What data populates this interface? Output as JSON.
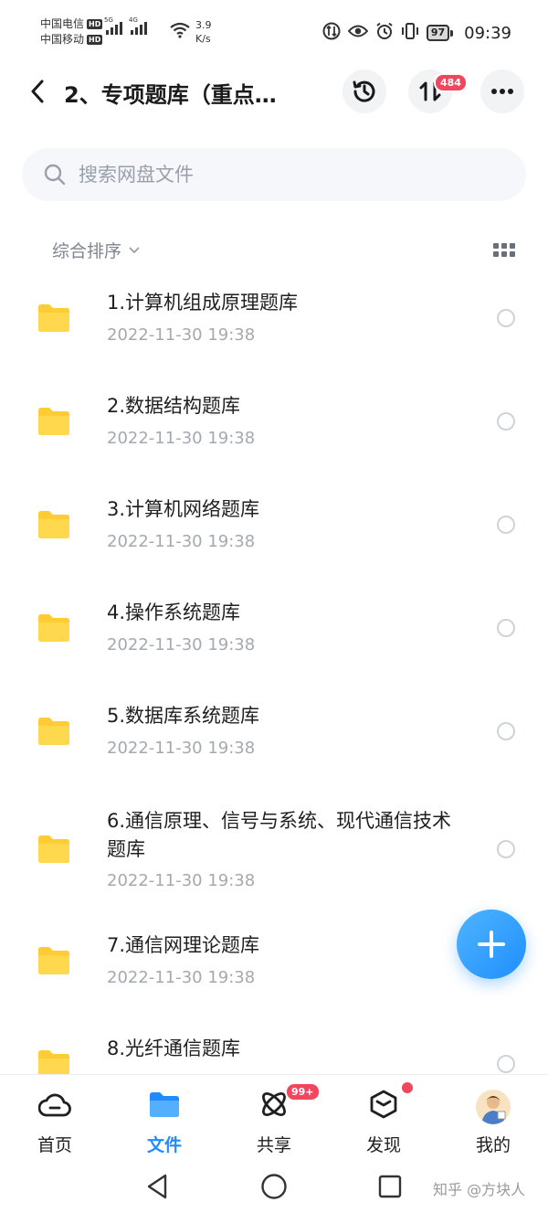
{
  "status_bar": {
    "carrier1": "中国电信",
    "carrier2": "中国移动",
    "hd": "HD",
    "net1": "5G",
    "net2": "4G",
    "speed_value": "3.9",
    "speed_unit": "K/s",
    "battery": "97",
    "time": "09:39"
  },
  "header": {
    "title": "2、专项题库（重点…",
    "transfer_badge": "484",
    "icons": [
      "back-icon",
      "history-icon",
      "transfer-icon",
      "more-icon"
    ]
  },
  "search": {
    "placeholder": "搜索网盘文件"
  },
  "sort": {
    "label": "综合排序"
  },
  "files": [
    {
      "name": "1.计算机组成原理题库",
      "date": "2022-11-30  19:38"
    },
    {
      "name": "2.数据结构题库",
      "date": "2022-11-30  19:38"
    },
    {
      "name": "3.计算机网络题库",
      "date": "2022-11-30  19:38"
    },
    {
      "name": "4.操作系统题库",
      "date": "2022-11-30  19:38"
    },
    {
      "name": "5.数据库系统题库",
      "date": "2022-11-30  19:38"
    },
    {
      "name": "6.通信原理、信号与系统、现代通信技术题库",
      "date": "2022-11-30  19:38"
    },
    {
      "name": "7.通信网理论题库",
      "date": "2022-11-30  19:38"
    },
    {
      "name": "8.光纤通信题库",
      "date": ""
    }
  ],
  "bottom_nav": [
    {
      "label": "首页"
    },
    {
      "label": "文件"
    },
    {
      "label": "共享",
      "badge": "99+"
    },
    {
      "label": "发现"
    },
    {
      "label": "我的"
    }
  ],
  "watermark": "知乎 @方块人",
  "colors": {
    "accent": "#1f8bff",
    "badge": "#f0465e",
    "folder": "#ffcc33",
    "muted_text": "#a4a9b1"
  }
}
